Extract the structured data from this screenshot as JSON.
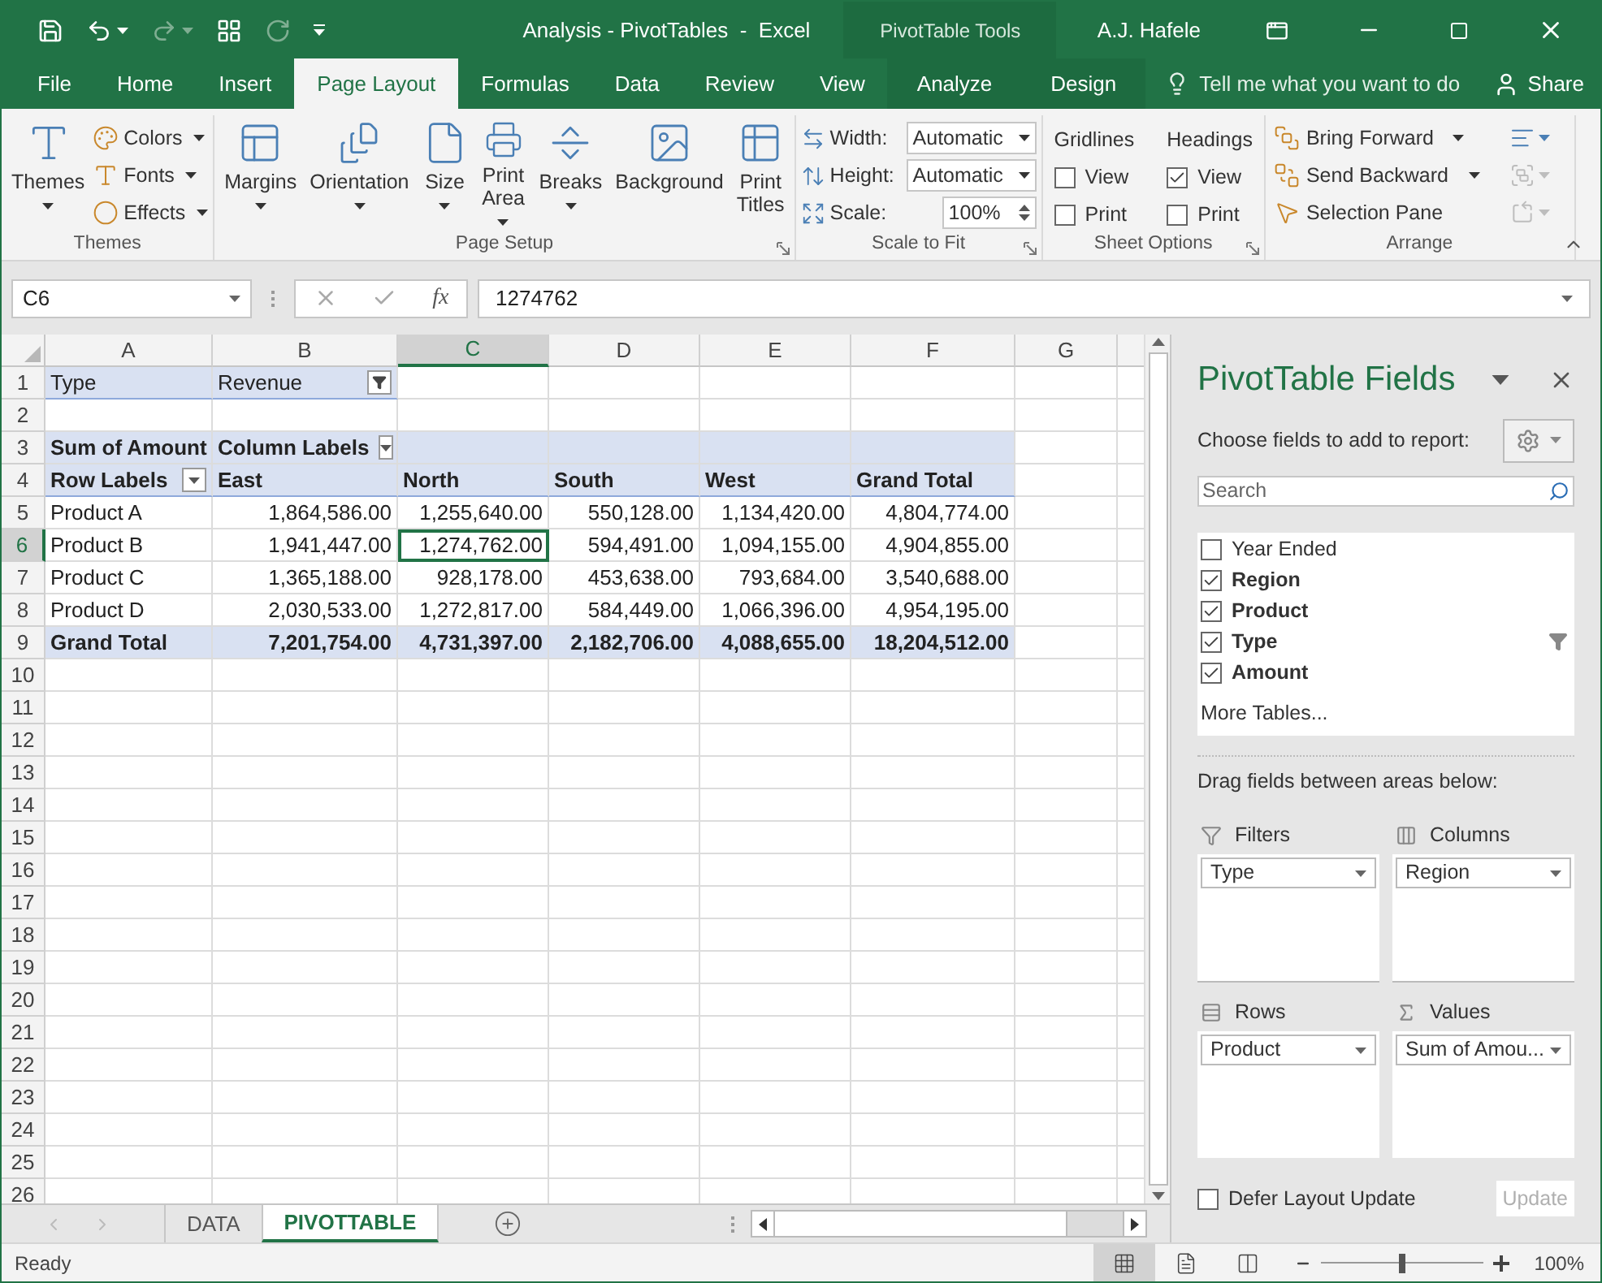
{
  "title_bar": {
    "title": "Analysis - PivotTables  -  Excel",
    "context_label": "PivotTable Tools",
    "user": "A.J. Hafele"
  },
  "ribbon_tabs": [
    {
      "label": "File",
      "selected": false,
      "kind": "normal"
    },
    {
      "label": "Home",
      "selected": false,
      "kind": "normal"
    },
    {
      "label": "Insert",
      "selected": false,
      "kind": "normal"
    },
    {
      "label": "Page Layout",
      "selected": true,
      "kind": "normal"
    },
    {
      "label": "Formulas",
      "selected": false,
      "kind": "normal"
    },
    {
      "label": "Data",
      "selected": false,
      "kind": "normal"
    },
    {
      "label": "Review",
      "selected": false,
      "kind": "normal"
    },
    {
      "label": "View",
      "selected": false,
      "kind": "normal"
    },
    {
      "label": "Analyze",
      "selected": false,
      "kind": "context"
    },
    {
      "label": "Design",
      "selected": false,
      "kind": "context"
    }
  ],
  "tell_me": {
    "placeholder": "Tell me what you want to do"
  },
  "share": "Share",
  "ribbon_groups": [
    {
      "kind": "themes",
      "label": "Themes",
      "launcher": false,
      "items": [
        {
          "kind": "large",
          "label": "Themes",
          "dropdown": true
        },
        {
          "kind": "small",
          "label": "Colors",
          "dropdown": true
        },
        {
          "kind": "small",
          "label": "Fonts",
          "dropdown": true
        },
        {
          "kind": "small",
          "label": "Effects",
          "dropdown": true
        }
      ]
    },
    {
      "kind": "page_setup",
      "label": "Page Setup",
      "launcher": true,
      "items": [
        {
          "kind": "large",
          "label": "Margins",
          "dropdown": true
        },
        {
          "kind": "large",
          "label": "Orientation",
          "dropdown": true
        },
        {
          "kind": "large",
          "label": "Size",
          "dropdown": true
        },
        {
          "kind": "large",
          "label": "Print Area",
          "dropdown": true
        },
        {
          "kind": "large",
          "label": "Breaks",
          "dropdown": true
        },
        {
          "kind": "large",
          "label": "Background",
          "dropdown": false
        },
        {
          "kind": "large",
          "label": "Print Titles",
          "dropdown": false
        }
      ]
    },
    {
      "kind": "scale",
      "label": "Scale to Fit",
      "launcher": true,
      "items": [
        {
          "kind": "field",
          "label": "Width:",
          "value": "Automatic"
        },
        {
          "kind": "field",
          "label": "Height:",
          "value": "Automatic"
        },
        {
          "kind": "spin",
          "label": "Scale:",
          "value": "100%"
        }
      ]
    },
    {
      "kind": "sheet_options",
      "label": "Sheet Options",
      "launcher": true,
      "items": [
        {
          "kind": "options",
          "title": "Gridlines",
          "options": [
            {
              "label": "View",
              "checked": false
            },
            {
              "label": "Print",
              "checked": false
            }
          ]
        },
        {
          "kind": "options",
          "title": "Headings",
          "options": [
            {
              "label": "View",
              "checked": true
            },
            {
              "label": "Print",
              "checked": false
            }
          ]
        }
      ]
    },
    {
      "kind": "arrange",
      "label": "Arrange",
      "launcher": false,
      "items": [
        {
          "kind": "small",
          "label": "Bring Forward",
          "dropdown": true
        },
        {
          "kind": "small",
          "label": "Send Backward",
          "dropdown": true
        },
        {
          "kind": "small",
          "label": "Selection Pane",
          "dropdown": false
        },
        {
          "kind": "icon",
          "disabled": false
        },
        {
          "kind": "icon",
          "disabled": true
        },
        {
          "kind": "icon",
          "disabled": true
        }
      ]
    }
  ],
  "formula_bar": {
    "name_box": "C6",
    "function_label": "fx",
    "value": "1274762"
  },
  "columns": [
    {
      "label": "A",
      "selected": false
    },
    {
      "label": "B",
      "selected": false
    },
    {
      "label": "C",
      "selected": true
    },
    {
      "label": "D",
      "selected": false
    },
    {
      "label": "E",
      "selected": false
    },
    {
      "label": "F",
      "selected": false
    },
    {
      "label": "G",
      "selected": false
    }
  ],
  "row_numbers": [
    {
      "label": "1",
      "selected": false
    },
    {
      "label": "2",
      "selected": false
    },
    {
      "label": "3",
      "selected": false
    },
    {
      "label": "4",
      "selected": false
    },
    {
      "label": "5",
      "selected": false
    },
    {
      "label": "6",
      "selected": true
    },
    {
      "label": "7",
      "selected": false
    },
    {
      "label": "8",
      "selected": false
    },
    {
      "label": "9",
      "selected": false
    },
    {
      "label": "10",
      "selected": false
    },
    {
      "label": "11",
      "selected": false
    },
    {
      "label": "12",
      "selected": false
    },
    {
      "label": "13",
      "selected": false
    },
    {
      "label": "14",
      "selected": false
    },
    {
      "label": "15",
      "selected": false
    },
    {
      "label": "16",
      "selected": false
    },
    {
      "label": "17",
      "selected": false
    },
    {
      "label": "18",
      "selected": false
    },
    {
      "label": "19",
      "selected": false
    },
    {
      "label": "20",
      "selected": false
    },
    {
      "label": "21",
      "selected": false
    },
    {
      "label": "22",
      "selected": false
    },
    {
      "label": "23",
      "selected": false
    },
    {
      "label": "24",
      "selected": false
    },
    {
      "label": "25",
      "selected": false
    },
    {
      "label": "26",
      "selected": false
    }
  ],
  "pivot": {
    "filter_field": "Type",
    "filter_value": "Revenue",
    "value_label": "Sum of Amount",
    "column_labels": "Column Labels",
    "row_labels": "Row Labels",
    "columns": [
      "East",
      "North",
      "South",
      "West",
      "Grand Total"
    ],
    "rows": [
      {
        "kind": "item",
        "label": "Product A",
        "values": [
          {
            "text": "1,864,586.00",
            "selected": false
          },
          {
            "text": "1,255,640.00",
            "selected": false
          },
          {
            "text": "550,128.00",
            "selected": false
          },
          {
            "text": "1,134,420.00",
            "selected": false
          },
          {
            "text": "4,804,774.00",
            "selected": false
          }
        ]
      },
      {
        "kind": "item",
        "label": "Product B",
        "values": [
          {
            "text": "1,941,447.00",
            "selected": false
          },
          {
            "text": "1,274,762.00",
            "selected": true
          },
          {
            "text": "594,491.00",
            "selected": false
          },
          {
            "text": "1,094,155.00",
            "selected": false
          },
          {
            "text": "4,904,855.00",
            "selected": false
          }
        ]
      },
      {
        "kind": "item",
        "label": "Product C",
        "values": [
          {
            "text": "1,365,188.00",
            "selected": false
          },
          {
            "text": "928,178.00",
            "selected": false
          },
          {
            "text": "453,638.00",
            "selected": false
          },
          {
            "text": "793,684.00",
            "selected": false
          },
          {
            "text": "3,540,688.00",
            "selected": false
          }
        ]
      },
      {
        "kind": "item",
        "label": "Product D",
        "values": [
          {
            "text": "2,030,533.00",
            "selected": false
          },
          {
            "text": "1,272,817.00",
            "selected": false
          },
          {
            "text": "584,449.00",
            "selected": false
          },
          {
            "text": "1,066,396.00",
            "selected": false
          },
          {
            "text": "4,954,195.00",
            "selected": false
          }
        ]
      },
      {
        "kind": "total",
        "label": "Grand Total",
        "values": [
          {
            "text": "7,201,754.00",
            "selected": false
          },
          {
            "text": "4,731,397.00",
            "selected": false
          },
          {
            "text": "2,182,706.00",
            "selected": false
          },
          {
            "text": "4,088,655.00",
            "selected": false
          },
          {
            "text": "18,204,512.00",
            "selected": false
          }
        ]
      }
    ]
  },
  "sheet_tabs": [
    {
      "label": "DATA",
      "selected": false
    },
    {
      "label": "PIVOTTABLE",
      "selected": true
    }
  ],
  "status_bar": {
    "text": "Ready",
    "views": [
      {
        "kind": "normal",
        "selected": true
      },
      {
        "kind": "page_layout",
        "selected": false
      },
      {
        "kind": "page_break",
        "selected": false
      }
    ],
    "zoom": {
      "level": 0.5,
      "reading": "100%"
    }
  },
  "field_pane": {
    "title": "PivotTable Fields",
    "subtitle": "Choose fields to add to report:",
    "search": {
      "placeholder": "Search"
    },
    "fields": [
      {
        "label": "Year Ended",
        "checked": false,
        "filtered": false
      },
      {
        "label": "Region",
        "checked": true,
        "filtered": false
      },
      {
        "label": "Product",
        "checked": true,
        "filtered": false
      },
      {
        "label": "Type",
        "checked": true,
        "filtered": true
      },
      {
        "label": "Amount",
        "checked": true,
        "filtered": false
      }
    ],
    "more_tables": "More Tables...",
    "areas_hint": "Drag fields between areas below:",
    "areas": [
      {
        "kind": "filters",
        "title": "Filters",
        "items": [
          "Type"
        ]
      },
      {
        "kind": "columns",
        "title": "Columns",
        "items": [
          "Region"
        ]
      },
      {
        "kind": "rows",
        "title": "Rows",
        "items": [
          "Product"
        ]
      },
      {
        "kind": "values",
        "title": "Values",
        "items": [
          "Sum of Amou..."
        ]
      }
    ],
    "defer": {
      "label": "Defer Layout Update",
      "checked": false
    },
    "update": {
      "label": "Update",
      "disabled": true
    }
  }
}
